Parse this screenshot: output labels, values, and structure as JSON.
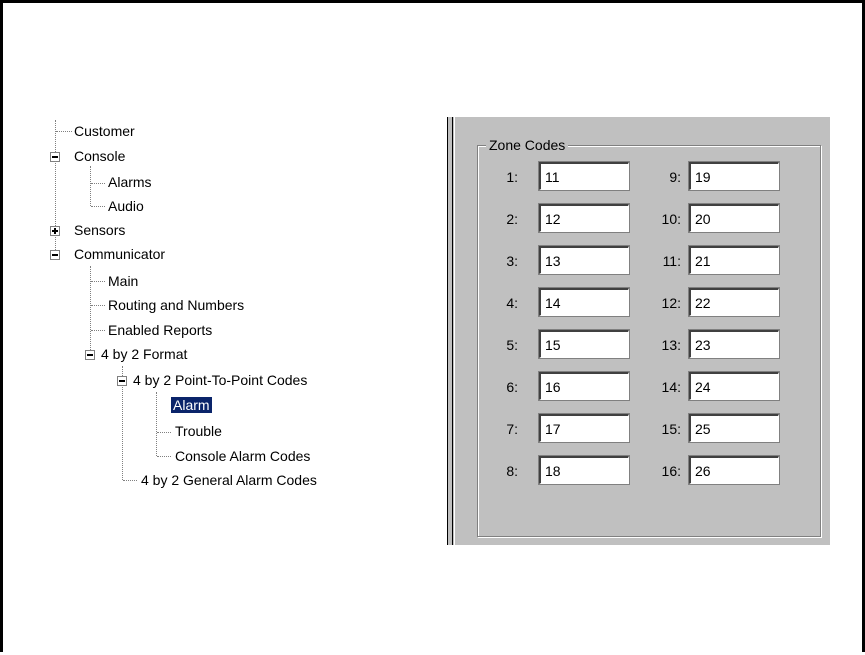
{
  "tree": {
    "items": [
      {
        "label": "Customer",
        "depth": 0
      },
      {
        "label": "Console",
        "depth": 0,
        "toggle": "minus"
      },
      {
        "label": "Alarms",
        "depth": 1
      },
      {
        "label": "Audio",
        "depth": 1
      },
      {
        "label": "Sensors",
        "depth": 0,
        "toggle": "plus"
      },
      {
        "label": "Communicator",
        "depth": 0,
        "toggle": "minus"
      },
      {
        "label": "Main",
        "depth": 1
      },
      {
        "label": "Routing and Numbers",
        "depth": 1
      },
      {
        "label": "Enabled Reports",
        "depth": 1
      },
      {
        "label": "4 by 2 Format",
        "depth": 1,
        "toggle": "minus"
      },
      {
        "label": "4 by 2 Point-To-Point Codes",
        "depth": 2,
        "toggle": "minus"
      },
      {
        "label": "Alarm",
        "depth": 3,
        "selected": true
      },
      {
        "label": "Trouble",
        "depth": 3
      },
      {
        "label": "Console Alarm Codes",
        "depth": 3
      },
      {
        "label": "4 by 2 General Alarm Codes",
        "depth": 2
      }
    ]
  },
  "zone_codes": {
    "title": "Zone Codes",
    "left": [
      {
        "label": "1:",
        "value": "11"
      },
      {
        "label": "2:",
        "value": "12"
      },
      {
        "label": "3:",
        "value": "13"
      },
      {
        "label": "4:",
        "value": "14"
      },
      {
        "label": "5:",
        "value": "15"
      },
      {
        "label": "6:",
        "value": "16"
      },
      {
        "label": "7:",
        "value": "17"
      },
      {
        "label": "8:",
        "value": "18"
      }
    ],
    "right": [
      {
        "label": "9:",
        "value": "19"
      },
      {
        "label": "10:",
        "value": "20"
      },
      {
        "label": "11:",
        "value": "21"
      },
      {
        "label": "12:",
        "value": "22"
      },
      {
        "label": "13:",
        "value": "23"
      },
      {
        "label": "14:",
        "value": "24"
      },
      {
        "label": "15:",
        "value": "25"
      },
      {
        "label": "16:",
        "value": "26"
      }
    ]
  }
}
